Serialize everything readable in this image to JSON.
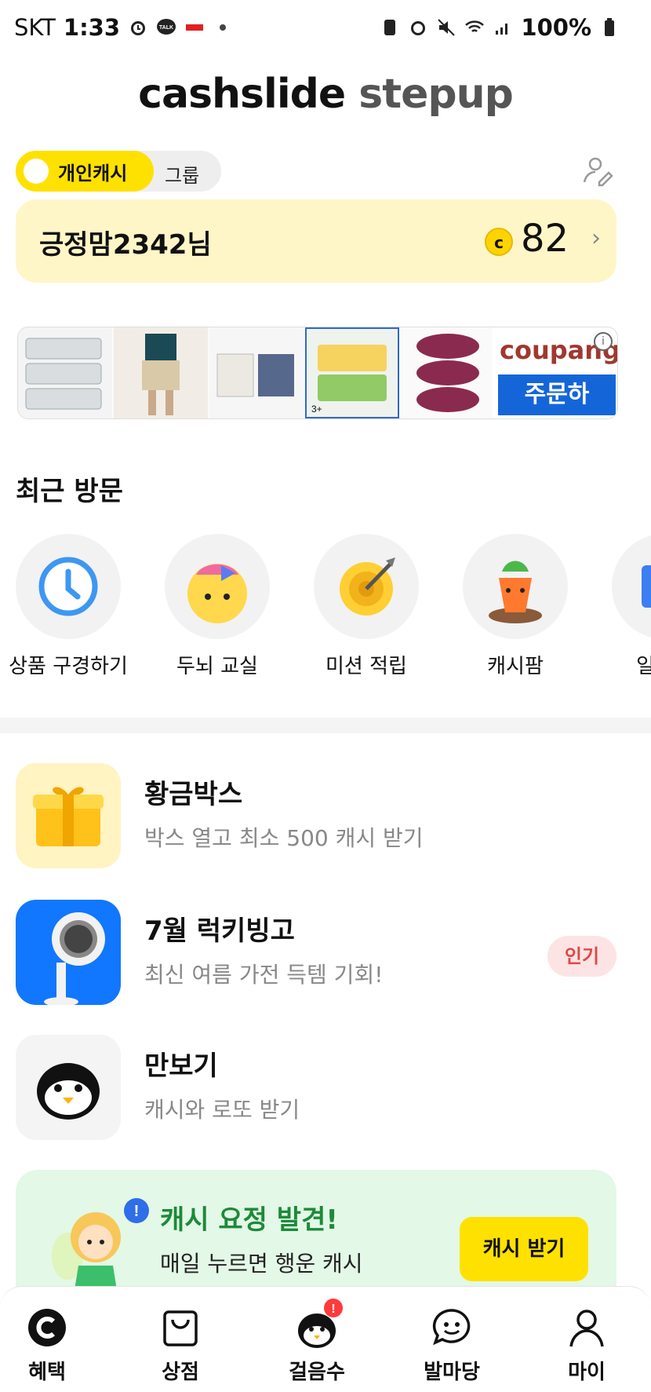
{
  "status_bar": {
    "carrier": "SKT",
    "time": "1:33",
    "battery": "100%"
  },
  "title": {
    "main": "cashslide",
    "sub": "stepup"
  },
  "toggle": {
    "active": "개인캐시",
    "inactive": "그룹"
  },
  "user": {
    "name": "긍정맘2342님",
    "coin_symbol": "c",
    "points": "82"
  },
  "banner": {
    "brand": "coupang",
    "cta": "주문하",
    "tag": "3+"
  },
  "recent": {
    "title": "최근 방문",
    "items": [
      {
        "label": "상품 구경하기",
        "icon": "clock-icon"
      },
      {
        "label": "두뇌 교실",
        "icon": "brain-character-icon"
      },
      {
        "label": "미션 적립",
        "icon": "target-icon"
      },
      {
        "label": "캐시팜",
        "icon": "carrot-icon"
      },
      {
        "label": "일주일",
        "icon": "calendar-icon"
      }
    ]
  },
  "list": [
    {
      "title": "황금박스",
      "subtitle": "박스 열고 최소 500 캐시 받기",
      "icon": "gift-box-icon"
    },
    {
      "title": "7월 럭키빙고",
      "subtitle": "최신 여름 가전 득템 기회!",
      "badge": "인기",
      "icon": "fan-icon"
    },
    {
      "title": "만보기",
      "subtitle": "캐시와 로또 받기",
      "icon": "penguin-icon"
    }
  ],
  "fairy": {
    "title": "캐시 요정 발견!",
    "subtitle": "매일 누르면 행운 캐시",
    "button": "캐시 받기"
  },
  "tabs": [
    {
      "label": "혜택",
      "icon": "cash-c-icon"
    },
    {
      "label": "상점",
      "icon": "shopping-bag-icon"
    },
    {
      "label": "걸음수",
      "icon": "penguin-icon"
    },
    {
      "label": "발마당",
      "icon": "chat-smile-icon"
    },
    {
      "label": "마이",
      "icon": "person-icon"
    }
  ],
  "colors": {
    "accent": "#ffe100",
    "card_bg": "#fff6c8",
    "badge_red": "#e04848",
    "fairy_green": "#1d8a3a"
  }
}
